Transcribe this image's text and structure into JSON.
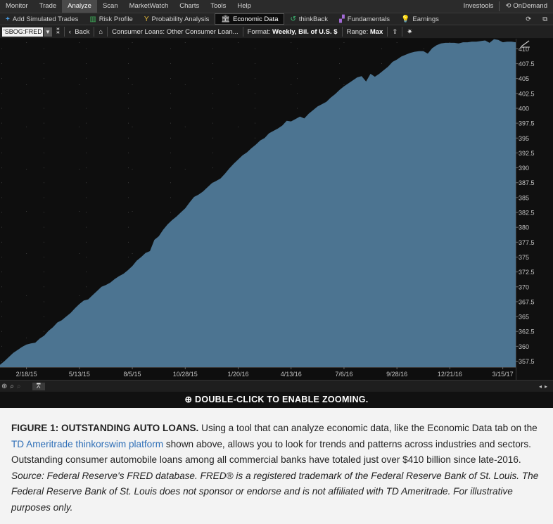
{
  "menubar": {
    "items": [
      "Monitor",
      "Trade",
      "Analyze",
      "Scan",
      "MarketWatch",
      "Charts",
      "Tools",
      "Help"
    ],
    "active": "Analyze",
    "right": [
      "Investools",
      "OnDemand"
    ]
  },
  "tabs": {
    "items": [
      {
        "label": "Add Simulated Trades",
        "icon": "plus-icon"
      },
      {
        "label": "Risk Profile",
        "icon": "risk-profile-icon"
      },
      {
        "label": "Probability Analysis",
        "icon": "probability-icon"
      },
      {
        "label": "Economic Data",
        "icon": "bank-icon"
      },
      {
        "label": "thinkBack",
        "icon": "history-icon"
      },
      {
        "label": "Fundamentals",
        "icon": "fundamentals-icon"
      },
      {
        "label": "Earnings",
        "icon": "lightbulb-icon"
      }
    ],
    "active": "Economic Data"
  },
  "toolbar": {
    "symbol": "'SBOG:FRED",
    "back_label": "Back",
    "description": "Consumer Loans: Other Consumer Loan...",
    "format_label": "Format:",
    "format_value": "Weekly, Bil. of U.S. $",
    "range_label": "Range:",
    "range_value": "Max"
  },
  "chart_data": {
    "type": "area",
    "x_tick_labels": [
      "2/18/15",
      "5/13/15",
      "8/5/15",
      "10/28/15",
      "1/20/16",
      "4/13/16",
      "7/6/16",
      "9/28/16",
      "12/21/16",
      "3/15/17"
    ],
    "y_tick_labels": [
      "357.5",
      "360",
      "362.5",
      "365",
      "367.5",
      "370",
      "372.5",
      "375",
      "377.5",
      "380",
      "382.5",
      "385",
      "387.5",
      "390",
      "392.5",
      "395",
      "397.5",
      "400",
      "402.5",
      "405",
      "407.5",
      "410"
    ],
    "ylim": [
      356.5,
      411.7
    ],
    "color": "#4c7491",
    "x_start": "2015-01-07",
    "x_step_days": 7,
    "values": [
      356.9,
      357.5,
      358.2,
      358.9,
      359.4,
      359.9,
      360.3,
      360.5,
      360.6,
      361.3,
      361.8,
      362.6,
      363.2,
      364.0,
      364.4,
      365.0,
      365.6,
      366.4,
      367.1,
      367.7,
      367.9,
      368.6,
      369.3,
      370.0,
      370.3,
      370.7,
      371.3,
      371.8,
      372.2,
      372.8,
      373.5,
      374.4,
      375.0,
      375.7,
      376.0,
      377.9,
      378.5,
      379.6,
      380.5,
      381.2,
      381.8,
      382.5,
      383.2,
      384.2,
      385.1,
      385.5,
      386.0,
      386.7,
      387.4,
      387.8,
      388.2,
      389.0,
      389.9,
      390.7,
      391.4,
      392.1,
      392.6,
      393.3,
      393.9,
      394.6,
      395.0,
      395.8,
      396.2,
      396.6,
      397.1,
      397.9,
      397.8,
      398.2,
      398.6,
      398.3,
      399.1,
      399.7,
      400.3,
      400.7,
      401.1,
      401.8,
      402.4,
      403.1,
      403.7,
      404.2,
      404.7,
      405.2,
      405.4,
      404.5,
      405.8,
      405.3,
      405.8,
      406.4,
      407.0,
      407.8,
      408.2,
      408.7,
      409.0,
      409.3,
      409.5,
      409.6,
      409.6,
      409.2,
      410.1,
      410.6,
      410.9,
      411.0,
      411.0,
      411.0,
      410.9,
      411.1,
      411.1,
      411.2,
      411.2,
      411.3,
      411.4,
      411.0,
      411.6,
      411.5,
      411.1,
      411.2,
      411.2,
      411.1
    ]
  },
  "zoom_hint": "DOUBLE-CLICK TO ENABLE ZOOMING.",
  "caption": {
    "figure_label": "FIGURE 1: OUTSTANDING AUTO LOANS.",
    "text1": " Using a tool that can analyze economic data, like the Economic Data tab on the ",
    "link": "TD Ameritrade thinkorswim platform",
    "text2": " shown above, allows you to look for trends and patterns across industries and sectors. Outstanding consumer automobile loans among all commercial banks have totaled just over $410 billion since late-2016. ",
    "source": "Source: Federal Reserve's FRED database. FRED® is a registered trademark of the Federal Reserve Bank of St. Louis. The Federal Reserve Bank of St. Louis does not sponsor or endorse and is not affiliated with TD Ameritrade. For illustrative purposes only."
  }
}
